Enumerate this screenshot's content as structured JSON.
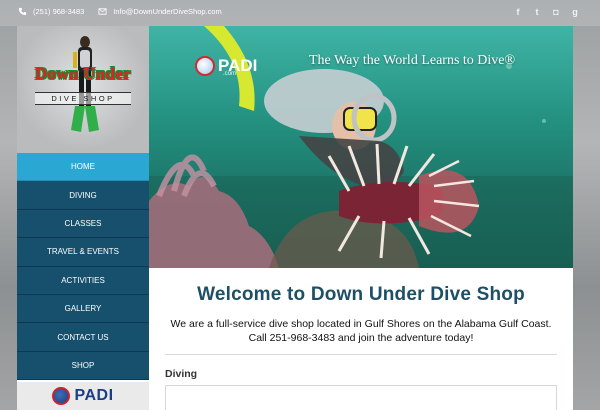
{
  "topbar": {
    "phone": "(251) 968-3483",
    "email": "Info@DownUnderDiveShop.com",
    "social": [
      {
        "icon": "facebook-icon",
        "glyph": "f"
      },
      {
        "icon": "twitter-icon",
        "glyph": "t"
      },
      {
        "icon": "instagram-icon",
        "glyph": "◘"
      },
      {
        "icon": "google-plus-icon",
        "glyph": "g"
      }
    ]
  },
  "logo": {
    "title": "Down Under",
    "subtitle": "DIVE SHOP"
  },
  "nav": {
    "items": [
      {
        "label": "HOME",
        "active": true
      },
      {
        "label": "DIVING",
        "active": false
      },
      {
        "label": "CLASSES",
        "active": false
      },
      {
        "label": "TRAVEL & EVENTS",
        "active": false
      },
      {
        "label": "ACTIVITIES",
        "active": false
      },
      {
        "label": "GALLERY",
        "active": false
      },
      {
        "label": "CONTACT US",
        "active": false
      },
      {
        "label": "SHOP",
        "active": false
      }
    ]
  },
  "sidebar_badge": {
    "label": "PADI"
  },
  "hero": {
    "brand": "PADI",
    "brand_suffix": ".com",
    "tagline": "The Way the World Learns to Dive®"
  },
  "main": {
    "welcome": "Welcome to Down Under Dive Shop",
    "intro_line1": "We are a full-service dive shop located in Gulf Shores on the Alabama Gulf Coast.",
    "intro_line2": "Call 251-968-3483 and join the adventure today!",
    "section_heading": "Diving"
  },
  "colors": {
    "nav_bg": "#16506d",
    "nav_active": "#2aa7d3",
    "heading": "#1d4f67"
  }
}
